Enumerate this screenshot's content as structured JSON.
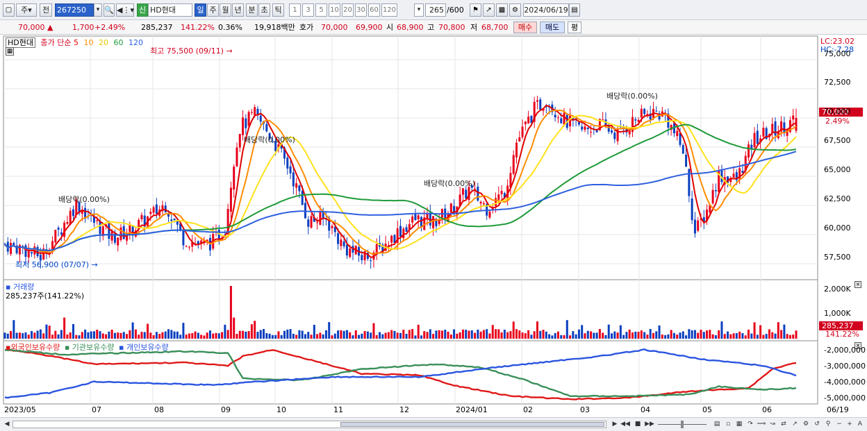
{
  "toolbar": {
    "period_unit": "주",
    "prev_label": "전",
    "code": "267250",
    "stock_badge": "신",
    "stock_name": "HD현대",
    "periods": [
      "일",
      "주",
      "월",
      "년",
      "분",
      "초",
      "틱"
    ],
    "active_period": "일",
    "intervals": [
      "1",
      "3",
      "5",
      "10",
      "20",
      "30",
      "60",
      "120"
    ],
    "count": "265",
    "count_total": "/600",
    "date": "2024/06/19"
  },
  "quote": {
    "price": "70,000",
    "change": "1,700",
    "change_pct": "+2.49%",
    "volume": "285,237",
    "volume_ratio": "141.22%",
    "turnover": "0.36%",
    "amount": "19,918백만",
    "ask_label": "호가",
    "ask": "70,000",
    "bid": "69,900",
    "open_label": "시",
    "open": "68,900",
    "high_label": "고",
    "high": "70,800",
    "low_label": "저",
    "low": "68,700",
    "buy_label": "매수",
    "sell_label": "매도",
    "eval_label": "평"
  },
  "price_panel": {
    "stock_tag": "HD현대",
    "ma_title": "종가 단순",
    "ma_periods": [
      "5",
      "10",
      "20",
      "60",
      "120"
    ],
    "lc_label": "LC:23.02",
    "hc_label": "HC:-7.28",
    "price_tag": "70,000",
    "pct_tag": "2.49%",
    "high_note": "최고 75,500 (09/11)",
    "low_note": "최저 56,900 (07/07)",
    "dividend_notes": [
      "배당락(0.00%)",
      "배당락(0.00%)",
      "배당락(0.00%)",
      "배당락(0.00%)"
    ],
    "y_ticks": [
      "75,000",
      "72,500",
      "70,000",
      "67,500",
      "65,000",
      "62,500",
      "60,000",
      "57,500"
    ]
  },
  "volume_panel": {
    "title": "거래량",
    "info": "285,237주(141.22%)",
    "y_ticks": [
      "2,000K",
      "1,000K"
    ],
    "tag_value": "285,237",
    "tag_pct": "141.22%"
  },
  "holding_panel": {
    "series": [
      "외국인보유수량",
      "기관보유수량",
      "개인보유수량"
    ],
    "y_ticks": [
      "-2,000,000",
      "-3,000,000",
      "-4,000,000",
      "-5,000,000"
    ]
  },
  "x_axis": [
    "2023/05",
    "07",
    "08",
    "09",
    "10",
    "11",
    "12",
    "2024/01",
    "02",
    "03",
    "04",
    "05",
    "06",
    "06/19"
  ],
  "colors": {
    "up": "#e8001c",
    "down": "#0a3fbf",
    "ma5": "#e00000",
    "ma10": "#ff8c00",
    "ma20": "#ffe11a",
    "ma60": "#1e9a38",
    "ma120": "#2e5fe0",
    "foreign": "#e01818",
    "institution": "#3a8f5a",
    "individual": "#2a55e0"
  },
  "chart_data": {
    "type": "candlestick",
    "price_range": [
      56900,
      75500
    ],
    "anchors": [
      [
        0,
        59200
      ],
      [
        6,
        58800
      ],
      [
        12,
        58100
      ],
      [
        18,
        60200
      ],
      [
        24,
        62700
      ],
      [
        30,
        61100
      ],
      [
        36,
        59800
      ],
      [
        42,
        60300
      ],
      [
        48,
        61400
      ],
      [
        54,
        62600
      ],
      [
        60,
        59700
      ],
      [
        66,
        59100
      ],
      [
        70,
        59400
      ],
      [
        74,
        60600
      ],
      [
        77,
        66500
      ],
      [
        79,
        69200
      ],
      [
        84,
        70300
      ],
      [
        90,
        68200
      ],
      [
        96,
        65400
      ],
      [
        102,
        61200
      ],
      [
        108,
        61300
      ],
      [
        114,
        58900
      ],
      [
        120,
        58100
      ],
      [
        126,
        58700
      ],
      [
        132,
        60200
      ],
      [
        138,
        61300
      ],
      [
        144,
        61100
      ],
      [
        150,
        62100
      ],
      [
        156,
        63900
      ],
      [
        162,
        62300
      ],
      [
        168,
        63700
      ],
      [
        172,
        67900
      ],
      [
        178,
        70700
      ],
      [
        182,
        71600
      ],
      [
        188,
        69800
      ],
      [
        194,
        68900
      ],
      [
        200,
        69400
      ],
      [
        206,
        68600
      ],
      [
        212,
        69900
      ],
      [
        218,
        70500
      ],
      [
        222,
        70200
      ],
      [
        228,
        67200
      ],
      [
        232,
        60100
      ],
      [
        236,
        62100
      ],
      [
        240,
        65100
      ],
      [
        246,
        64700
      ],
      [
        252,
        68200
      ],
      [
        258,
        68900
      ],
      [
        264,
        69600
      ],
      [
        266,
        70000
      ]
    ]
  }
}
